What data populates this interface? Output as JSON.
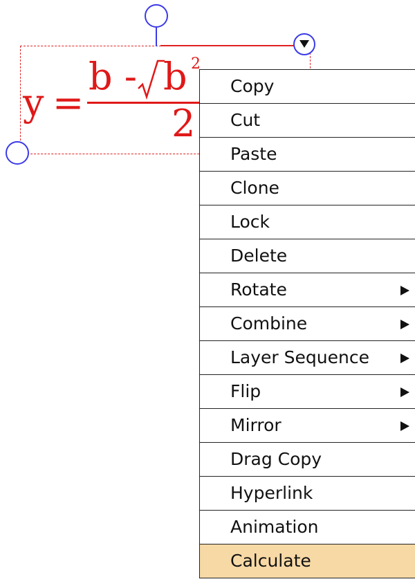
{
  "formula": {
    "lhs": "y",
    "equals": "=",
    "numerator": "b -",
    "radicand_base": "b",
    "radicand_exponent": "2",
    "denominator": "2",
    "color": "#e01818"
  },
  "selection": {
    "frame_color": "#e02020",
    "handle_color": "#3a3ae8"
  },
  "context_menu": {
    "items": [
      {
        "label": "Copy",
        "has_submenu": false
      },
      {
        "label": "Cut",
        "has_submenu": false
      },
      {
        "label": "Paste",
        "has_submenu": false
      },
      {
        "label": "Clone",
        "has_submenu": false
      },
      {
        "label": "Lock",
        "has_submenu": false
      },
      {
        "label": "Delete",
        "has_submenu": false
      },
      {
        "label": "Rotate",
        "has_submenu": true
      },
      {
        "label": "Combine",
        "has_submenu": true
      },
      {
        "label": "Layer Sequence",
        "has_submenu": true
      },
      {
        "label": "Flip",
        "has_submenu": true
      },
      {
        "label": "Mirror",
        "has_submenu": true
      },
      {
        "label": "Drag Copy",
        "has_submenu": false
      },
      {
        "label": "Hyperlink",
        "has_submenu": false
      },
      {
        "label": "Animation",
        "has_submenu": false
      },
      {
        "label": "Calculate",
        "has_submenu": false,
        "highlighted": true
      }
    ],
    "highlight_color": "#f7d9a6"
  }
}
